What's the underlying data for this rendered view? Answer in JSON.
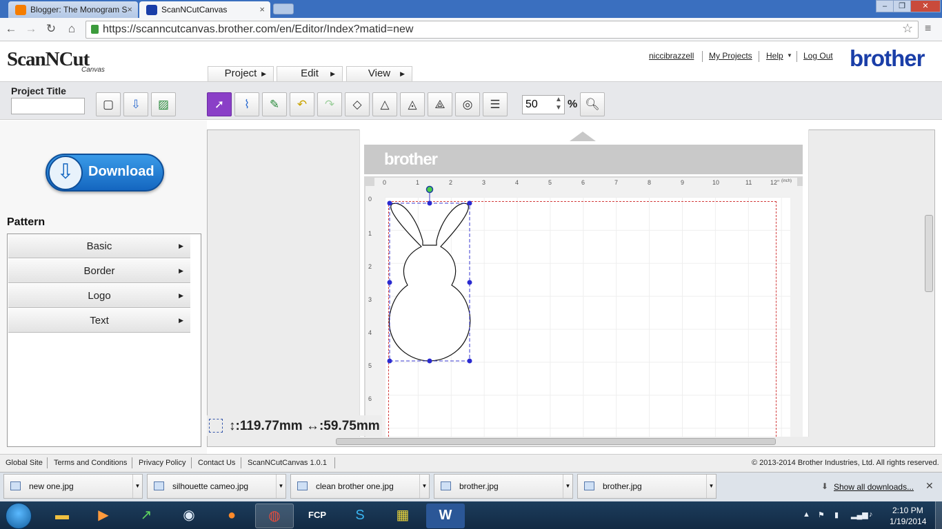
{
  "browser": {
    "tabs": [
      {
        "title": "Blogger: The Monogram S",
        "active": false
      },
      {
        "title": "ScanNCutCanvas",
        "active": true
      }
    ],
    "url": "https://scanncutcanvas.brother.com/en/Editor/Index?matid=new",
    "window_buttons": [
      "minimize",
      "restore",
      "close"
    ]
  },
  "header": {
    "logo_text": "ScanNCut",
    "logo_subtitle": "Canvas",
    "menus": [
      {
        "label": "Project"
      },
      {
        "label": "Edit"
      },
      {
        "label": "View"
      }
    ],
    "user_links": {
      "username": "niccibrazzell",
      "my_projects": "My Projects",
      "help": "Help",
      "logout": "Log Out"
    },
    "brand": "brother"
  },
  "toolbar": {
    "project_title_label": "Project Title",
    "project_title_value": "",
    "file_buttons": [
      "new-icon",
      "save-icon",
      "import-image-icon"
    ],
    "edit_tools": [
      "select-icon",
      "edit-points-icon",
      "draw-icon",
      "undo-icon",
      "redo-icon",
      "shape-1-icon",
      "shape-2-icon",
      "shape-3-icon",
      "shape-4-icon",
      "outline-icon",
      "align-icon"
    ],
    "zoom_value": "50",
    "zoom_unit": "%"
  },
  "sidebar": {
    "download_label": "Download",
    "pattern_title": "Pattern",
    "pattern_items": [
      {
        "label": "Basic"
      },
      {
        "label": "Border"
      },
      {
        "label": "Logo"
      },
      {
        "label": "Text"
      }
    ]
  },
  "canvas": {
    "mat_brand": "brother",
    "ruler_top": [
      "0",
      "1",
      "2",
      "3",
      "4",
      "5",
      "6",
      "7",
      "8",
      "9",
      "10",
      "11",
      "12\""
    ],
    "ruler_top_unit": "(inch)",
    "ruler_left": [
      "0",
      "1",
      "2",
      "3",
      "4",
      "5",
      "6"
    ],
    "selection_height": "119.77mm",
    "selection_width": "59.75mm"
  },
  "footer": {
    "links": [
      "Global Site",
      "Terms and Conditions",
      "Privacy Policy",
      "Contact Us",
      "ScanNCutCanvas 1.0.1"
    ],
    "copyright": "© 2013-2014 Brother Industries, Ltd. All rights reserved."
  },
  "downloads": {
    "items": [
      "new one.jpg",
      "silhouette cameo.jpg",
      "clean brother one.jpg",
      "brother.jpg",
      "brother.jpg"
    ],
    "show_all": "Show all downloads..."
  },
  "taskbar": {
    "clock_time": "2:10 PM",
    "clock_date": "1/19/2014",
    "apps": [
      "explorer-icon",
      "media-player-icon",
      "stock-app-icon",
      "wifi-app-icon",
      "firefox-icon",
      "chrome-icon",
      "fcp-icon",
      "skype-icon",
      "paint-icon",
      "word-icon"
    ]
  },
  "colors": {
    "accent_purple": "#8a3fc7",
    "brand_blue": "#1a3ea8",
    "selection_handle": "#2a2ad0",
    "cut_boundary": "#d23a3a"
  }
}
